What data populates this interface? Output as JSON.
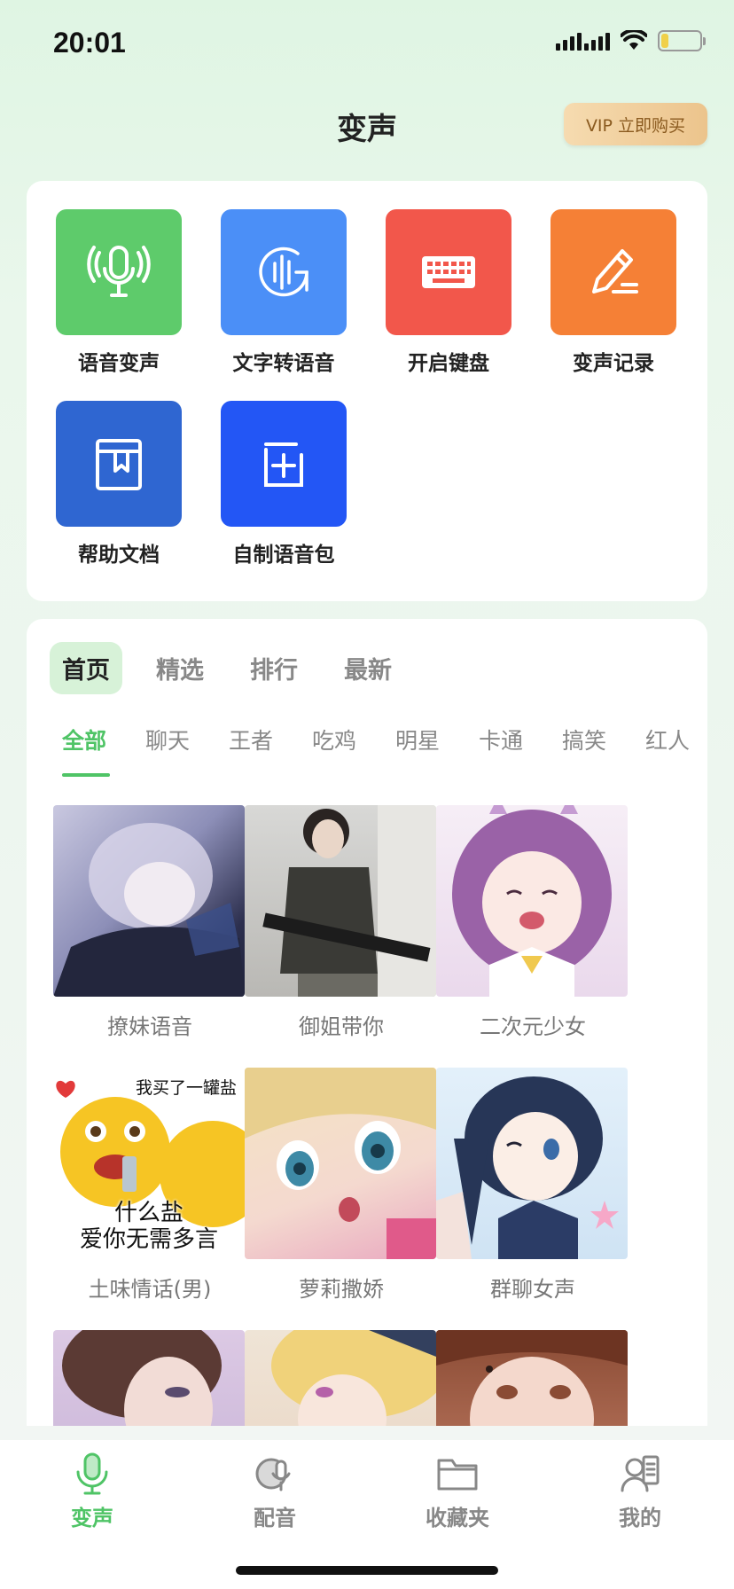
{
  "status": {
    "time": "20:01"
  },
  "header": {
    "title": "变声",
    "vip_label": "VIP 立即购买"
  },
  "tools": [
    {
      "label": "语音变声",
      "icon": "microphone-icon",
      "color": "#5ecb6b"
    },
    {
      "label": "文字转语音",
      "icon": "text-to-speech-icon",
      "color": "#4b8ff7"
    },
    {
      "label": "开启键盘",
      "icon": "keyboard-icon",
      "color": "#f2574b"
    },
    {
      "label": "变声记录",
      "icon": "pencil-icon",
      "color": "#f58036"
    },
    {
      "label": "帮助文档",
      "icon": "book-icon",
      "color": "#2f66d1"
    },
    {
      "label": "自制语音包",
      "icon": "add-box-icon",
      "color": "#2356f5"
    }
  ],
  "tabs": [
    "首页",
    "精选",
    "排行",
    "最新"
  ],
  "categories": [
    "全部",
    "聊天",
    "王者",
    "吃鸡",
    "明星",
    "卡通",
    "搞笑",
    "红人"
  ],
  "items": [
    {
      "label": "撩妹语音"
    },
    {
      "label": "御姐带你"
    },
    {
      "label": "二次元少女"
    },
    {
      "label": "土味情话(男)",
      "thumb_text_top": "我买了一罐盐",
      "thumb_text_bottom": "什么盐\n爱你无需多言"
    },
    {
      "label": "萝莉撒娇"
    },
    {
      "label": "群聊女声"
    },
    {
      "label": ""
    },
    {
      "label": ""
    },
    {
      "label": ""
    }
  ],
  "nav": [
    {
      "label": "变声",
      "icon": "microphone-icon"
    },
    {
      "label": "配音",
      "icon": "dubbing-icon"
    },
    {
      "label": "收藏夹",
      "icon": "folder-icon"
    },
    {
      "label": "我的",
      "icon": "profile-icon"
    }
  ],
  "colors": {
    "accent": "#4fc466",
    "vip": "#ecc48c"
  }
}
